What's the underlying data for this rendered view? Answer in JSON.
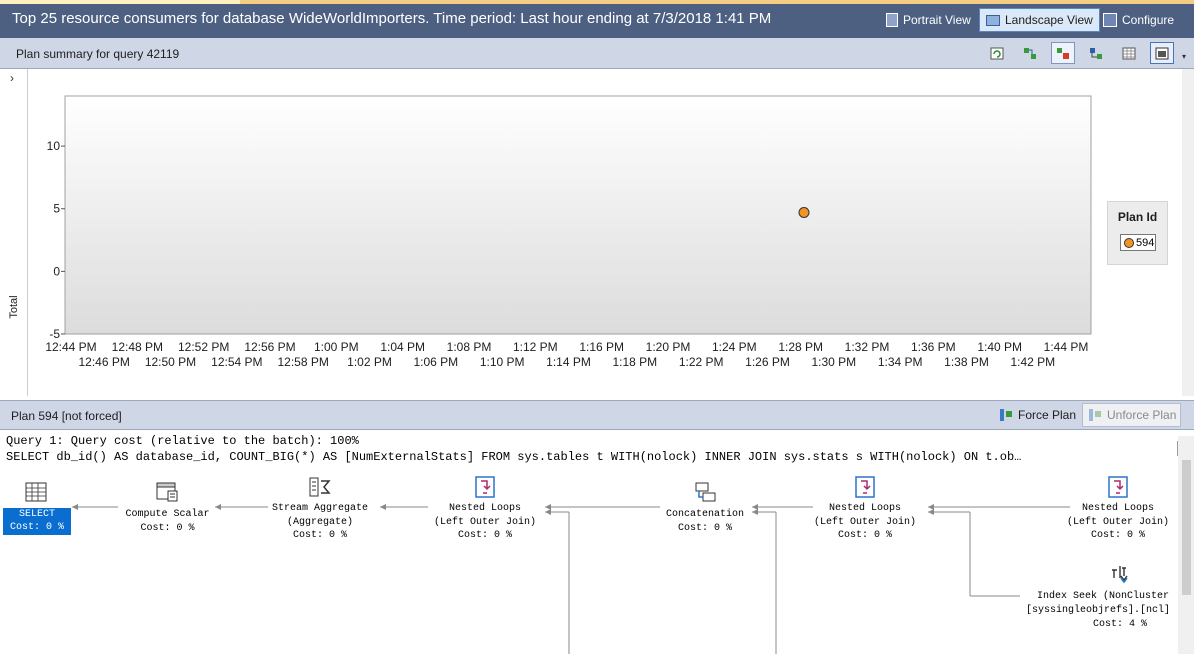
{
  "title": "Top 25 resource consumers for database WideWorldImporters. Time period: Last hour ending at 7/3/2018 1:41 PM",
  "toolbar": {
    "portrait": "Portrait View",
    "landscape": "Landscape View",
    "configure": "Configure"
  },
  "summary": {
    "title": "Plan summary for query 42119",
    "collapse_glyph": "›"
  },
  "chart_data": {
    "type": "scatter",
    "ylabel": "Total",
    "xlabel": "",
    "ylim": [
      -5,
      14
    ],
    "yticks": [
      -5,
      0,
      5,
      10
    ],
    "x_ticks_top": [
      "12:44 PM",
      "12:48 PM",
      "12:52 PM",
      "12:56 PM",
      "1:00 PM",
      "1:04 PM",
      "1:08 PM",
      "1:12 PM",
      "1:16 PM",
      "1:20 PM",
      "1:24 PM",
      "1:28 PM",
      "1:32 PM",
      "1:36 PM",
      "1:40 PM",
      "1:44 PM"
    ],
    "x_ticks_bottom": [
      "12:46 PM",
      "12:50 PM",
      "12:54 PM",
      "12:58 PM",
      "1:02 PM",
      "1:06 PM",
      "1:10 PM",
      "1:14 PM",
      "1:18 PM",
      "1:22 PM",
      "1:26 PM",
      "1:30 PM",
      "1:34 PM",
      "1:38 PM",
      "1:42 PM"
    ],
    "x_range_minutes": [
      0,
      60
    ],
    "series": [
      {
        "name": "594",
        "color": "#f39423",
        "points": [
          {
            "x_minute": 44.2,
            "y": 4.7
          }
        ]
      }
    ],
    "legend_title": "Plan Id",
    "legend_position": "right",
    "grid": false
  },
  "plan": {
    "label": "Plan 594 [not forced]",
    "force": "Force Plan",
    "unforce": "Unforce Plan",
    "query_header": "Query 1: Query cost (relative to the batch): 100%",
    "query_sql": "SELECT db_id() AS database_id, COUNT_BIG(*) AS [NumExternalStats] FROM sys.tables t WITH(nolock) INNER JOIN sys.stats s WITH(nolock) ON t.ob…",
    "nodes": {
      "select": {
        "line1": "SELECT",
        "line2": "Cost: 0 %"
      },
      "compute": {
        "line1": "Compute Scalar",
        "line2": "Cost: 0 %"
      },
      "stream": {
        "line1": "Stream Aggregate",
        "line2": "(Aggregate)",
        "line3": "Cost: 0 %"
      },
      "nested1": {
        "line1": "Nested Loops",
        "line2": "(Left Outer Join)",
        "line3": "Cost: 0 %"
      },
      "concat": {
        "line1": "Concatenation",
        "line2": "Cost: 0 %"
      },
      "nested2": {
        "line1": "Nested Loops",
        "line2": "(Left Outer Join)",
        "line3": "Cost: 0 %"
      },
      "nested3": {
        "line1": "Nested Loops",
        "line2": "(Left Outer Join)",
        "line3": "Cost: 0 %"
      },
      "seek": {
        "line1": "Index Seek (NonCluster",
        "line2": "[syssingleobjrefs].[ncl]",
        "line3": "Cost: 4 %"
      }
    }
  },
  "colors": {
    "titlebar": "#4d6082",
    "header": "#cfd7e6",
    "point": "#f39423",
    "select_highlight": "#0a6ed1"
  }
}
